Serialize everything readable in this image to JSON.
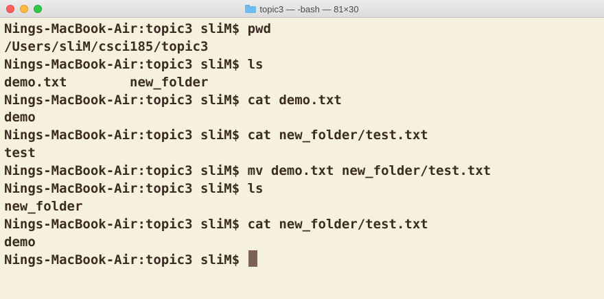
{
  "window": {
    "title": "topic3 — -bash — 81×30",
    "title_icon": "folder-icon"
  },
  "terminal": {
    "lines": [
      "Nings-MacBook-Air:topic3 sliM$ pwd",
      "/Users/sliM/csci185/topic3",
      "Nings-MacBook-Air:topic3 sliM$ ls",
      "demo.txt        new_folder",
      "Nings-MacBook-Air:topic3 sliM$ cat demo.txt",
      "demo",
      "Nings-MacBook-Air:topic3 sliM$ cat new_folder/test.txt",
      "test",
      "Nings-MacBook-Air:topic3 sliM$ mv demo.txt new_folder/test.txt",
      "Nings-MacBook-Air:topic3 sliM$ ls",
      "new_folder",
      "Nings-MacBook-Air:topic3 sliM$ cat new_folder/test.txt",
      "demo"
    ],
    "prompt": "Nings-MacBook-Air:topic3 sliM$ "
  },
  "colors": {
    "background": "#f5f1dc",
    "text": "#3b2b23",
    "cursor": "#7a6259"
  }
}
